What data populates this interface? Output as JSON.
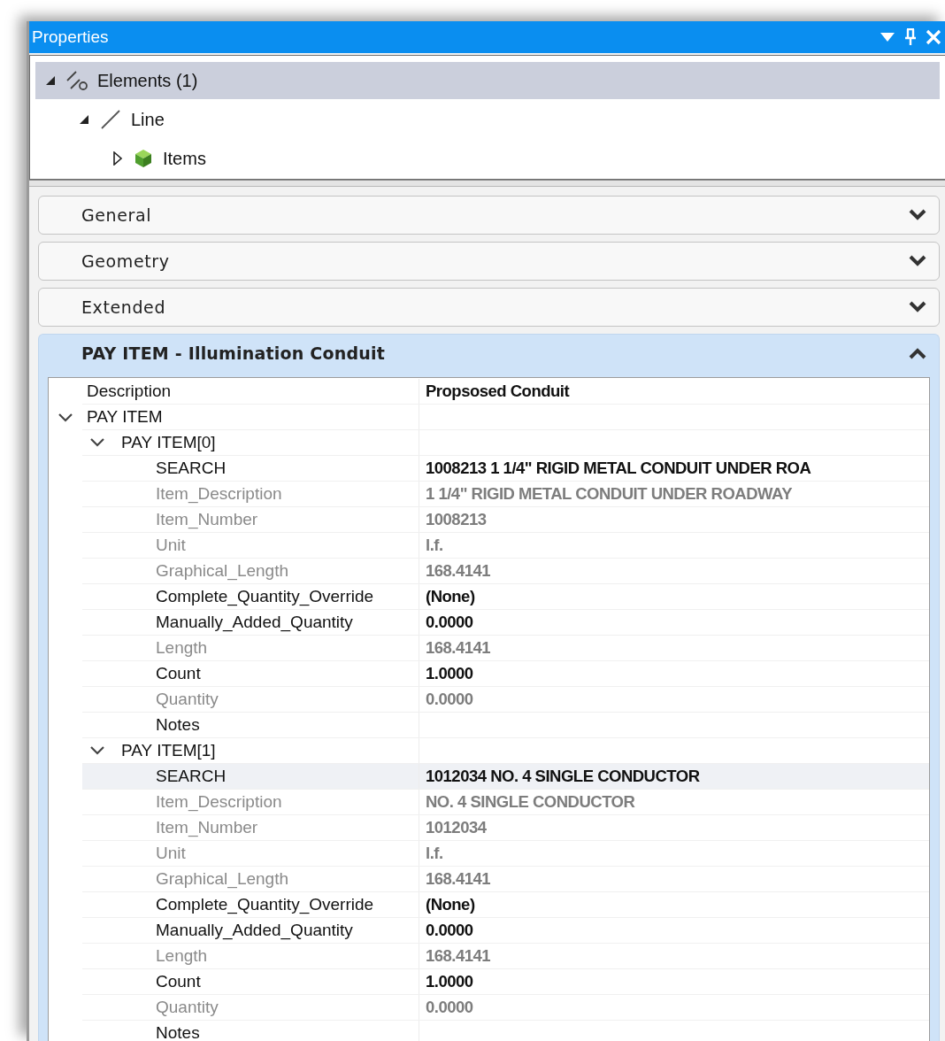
{
  "window": {
    "title": "Properties"
  },
  "tree": [
    {
      "label": "Elements (1)",
      "kind": "elements",
      "expanded": true,
      "selected": true,
      "children": [
        {
          "label": "Line",
          "kind": "line",
          "expanded": true,
          "selected": false,
          "children": [
            {
              "label": "Items",
              "kind": "items",
              "expanded": false,
              "selected": false
            }
          ]
        }
      ]
    }
  ],
  "sections": [
    {
      "title": "General",
      "expanded": false
    },
    {
      "title": "Geometry",
      "expanded": false
    },
    {
      "title": "Extended",
      "expanded": false
    },
    {
      "title": "PAY ITEM - Illumination Conduit",
      "expanded": true,
      "properties": [
        {
          "kind": "property",
          "name": "Description",
          "value": "Propsosed Conduit",
          "readonly": false,
          "selected": false
        },
        {
          "kind": "group",
          "name": "PAY ITEM",
          "expanded": true,
          "children": [
            {
              "kind": "group",
              "name": "PAY ITEM[0]",
              "expanded": true,
              "children": [
                {
                  "kind": "property",
                  "name": "SEARCH",
                  "value": "1008213 1 1/4\" RIGID METAL CONDUIT UNDER ROA",
                  "readonly": false,
                  "selected": false
                },
                {
                  "kind": "property",
                  "name": "Item_Description",
                  "value": "1 1/4\" RIGID METAL CONDUIT UNDER ROADWAY",
                  "readonly": true,
                  "selected": false
                },
                {
                  "kind": "property",
                  "name": "Item_Number",
                  "value": "1008213",
                  "readonly": true,
                  "selected": false
                },
                {
                  "kind": "property",
                  "name": "Unit",
                  "value": "l.f.",
                  "readonly": true,
                  "selected": false
                },
                {
                  "kind": "property",
                  "name": "Graphical_Length",
                  "value": "168.4141",
                  "readonly": true,
                  "selected": false
                },
                {
                  "kind": "property",
                  "name": "Complete_Quantity_Override",
                  "value": "(None)",
                  "readonly": false,
                  "selected": false
                },
                {
                  "kind": "property",
                  "name": "Manually_Added_Quantity",
                  "value": "0.0000",
                  "readonly": false,
                  "selected": false
                },
                {
                  "kind": "property",
                  "name": "Length",
                  "value": "168.4141",
                  "readonly": true,
                  "selected": false
                },
                {
                  "kind": "property",
                  "name": "Count",
                  "value": "1.0000",
                  "readonly": false,
                  "selected": false
                },
                {
                  "kind": "property",
                  "name": "Quantity",
                  "value": "0.0000",
                  "readonly": true,
                  "selected": false
                },
                {
                  "kind": "property",
                  "name": "Notes",
                  "readonly": false,
                  "selected": false
                }
              ]
            },
            {
              "kind": "group",
              "name": "PAY ITEM[1]",
              "expanded": true,
              "children": [
                {
                  "kind": "property",
                  "name": "SEARCH",
                  "value": "1012034 NO. 4 SINGLE CONDUCTOR",
                  "readonly": false,
                  "selected": true
                },
                {
                  "kind": "property",
                  "name": "Item_Description",
                  "value": "NO. 4 SINGLE CONDUCTOR",
                  "readonly": true,
                  "selected": false
                },
                {
                  "kind": "property",
                  "name": "Item_Number",
                  "value": "1012034",
                  "readonly": true,
                  "selected": false
                },
                {
                  "kind": "property",
                  "name": "Unit",
                  "value": "l.f.",
                  "readonly": true,
                  "selected": false
                },
                {
                  "kind": "property",
                  "name": "Graphical_Length",
                  "value": "168.4141",
                  "readonly": true,
                  "selected": false
                },
                {
                  "kind": "property",
                  "name": "Complete_Quantity_Override",
                  "value": "(None)",
                  "readonly": false,
                  "selected": false
                },
                {
                  "kind": "property",
                  "name": "Manually_Added_Quantity",
                  "value": "0.0000",
                  "readonly": false,
                  "selected": false
                },
                {
                  "kind": "property",
                  "name": "Length",
                  "value": "168.4141",
                  "readonly": true,
                  "selected": false
                },
                {
                  "kind": "property",
                  "name": "Count",
                  "value": "1.0000",
                  "readonly": false,
                  "selected": false
                },
                {
                  "kind": "property",
                  "name": "Quantity",
                  "value": "0.0000",
                  "readonly": true,
                  "selected": false
                },
                {
                  "kind": "property",
                  "name": "Notes",
                  "readonly": false,
                  "selected": false
                }
              ]
            }
          ]
        }
      ]
    }
  ]
}
